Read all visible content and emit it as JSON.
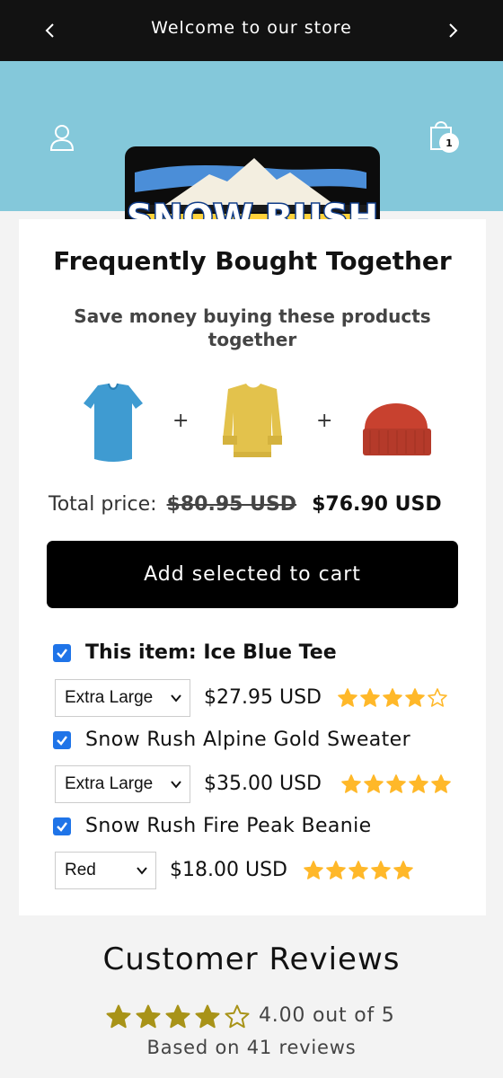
{
  "announcement": {
    "text": "Welcome to our store",
    "prev_icon": "chevron-left-icon",
    "next_icon": "chevron-right-icon"
  },
  "header": {
    "logo_text": "SNOW RUSH",
    "cart_count": "1",
    "background_color": "#84c8da"
  },
  "bundle": {
    "title": "Frequently Bought Together",
    "subtitle": "Save money buying these products together",
    "images": [
      "blue-tee-image",
      "yellow-sweater-image",
      "red-beanie-image"
    ],
    "total_label": "Total price:",
    "original_price": "$80.95 USD",
    "discounted_price": "$76.90 USD",
    "add_button_label": "Add selected to cart",
    "items": [
      {
        "name": "This item: Ice Blue Tee",
        "selected": true,
        "variant": "Extra Large",
        "price": "$27.95 USD",
        "rating": 4
      },
      {
        "name": "Snow Rush Alpine Gold Sweater",
        "selected": true,
        "variant": "Extra Large",
        "price": "$35.00 USD",
        "rating": 5
      },
      {
        "name": "Snow Rush Fire Peak Beanie",
        "selected": true,
        "variant": "Red",
        "price": "$18.00 USD",
        "rating": 5
      }
    ]
  },
  "reviews": {
    "title": "Customer Reviews",
    "rating": 4,
    "average_text": "4.00 out of 5",
    "count_text": "Based on 41 reviews",
    "star_color": "#a89318"
  },
  "colors": {
    "item_star_color": "#ffb829",
    "checkbox_color": "#1f74e8"
  }
}
